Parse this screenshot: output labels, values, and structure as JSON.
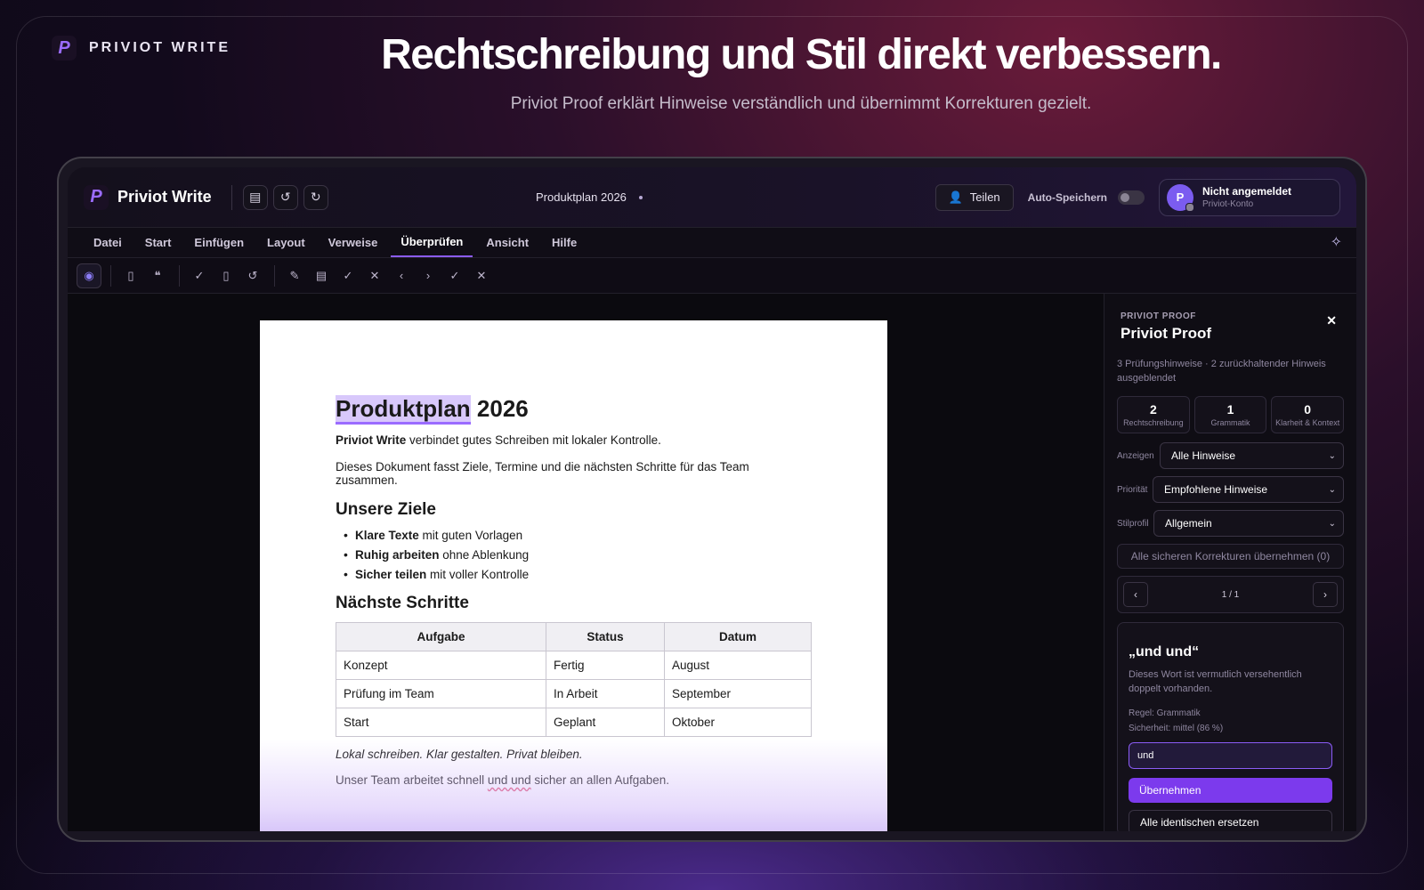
{
  "hero": {
    "brand": "PRIVIOT WRITE",
    "headline": "Rechtschreibung und Stil direkt verbessern.",
    "subline": "Priviot Proof erklärt Hinweise verständlich und übernimmt Korrekturen gezielt."
  },
  "topbar": {
    "app_name": "Priviot Write",
    "doc_title": "Produktplan 2026",
    "share_label": "Teilen",
    "autosave_label": "Auto-Speichern",
    "account_initial": "P",
    "account_name": "Nicht angemeldet",
    "account_sub": "Priviot-Konto"
  },
  "menu": [
    "Datei",
    "Start",
    "Einfügen",
    "Layout",
    "Verweise",
    "Überprüfen",
    "Ansicht",
    "Hilfe"
  ],
  "document": {
    "title_highlight": "Produktplan",
    "title_rest": " 2026",
    "p1_bold": "Priviot Write",
    "p1_rest": " verbindet gutes Schreiben mit lokaler Kontrolle.",
    "p2": "Dieses Dokument fasst Ziele, Termine und die nächsten Schritte für das Team zusammen.",
    "h2_goals": "Unsere Ziele",
    "goals": [
      {
        "bold": "Klare Texte",
        "rest": " mit guten Vorlagen"
      },
      {
        "bold": "Ruhig arbeiten",
        "rest": " ohne Ablenkung"
      },
      {
        "bold": "Sicher teilen",
        "rest": " mit voller Kontrolle"
      }
    ],
    "h2_steps": "Nächste Schritte",
    "table_headers": [
      "Aufgabe",
      "Status",
      "Datum"
    ],
    "table_rows": [
      [
        "Konzept",
        "Fertig",
        "August"
      ],
      [
        "Prüfung im Team",
        "In Arbeit",
        "September"
      ],
      [
        "Start",
        "Geplant",
        "Oktober"
      ]
    ],
    "tagline": "Lokal schreiben. Klar gestalten. Privat bleiben.",
    "last_before": "Unser Team arbeitet schnell ",
    "last_error": "und und",
    "last_after": " sicher an allen Aufgaben."
  },
  "panel": {
    "eyebrow": "PRIVIOT PROOF",
    "title": "Priviot Proof",
    "summary": "3 Prüfungshinweise · 2 zurückhaltender Hinweis ausgeblendet",
    "stats": [
      {
        "value": "2",
        "label": "Rechtschreibung"
      },
      {
        "value": "1",
        "label": "Grammatik"
      },
      {
        "value": "0",
        "label": "Klarheit & Kontext"
      }
    ],
    "filters": [
      {
        "label": "Anzeigen",
        "value": "Alle Hinweise"
      },
      {
        "label": "Priorität",
        "value": "Empfohlene Hinweise"
      },
      {
        "label": "Stilprofil",
        "value": "Allgemein"
      }
    ],
    "apply_all": "Alle sicheren Korrekturen übernehmen (0)",
    "pager": "1 / 1",
    "card": {
      "title": "„und und“",
      "desc": "Dieses Wort ist vermutlich versehentlich doppelt vorhanden.",
      "rule": "Regel: Grammatik",
      "confidence": "Sicherheit: mittel (86 %)",
      "suggestion": "und",
      "apply": "Übernehmen",
      "replace_all": "Alle identischen ersetzen"
    }
  }
}
